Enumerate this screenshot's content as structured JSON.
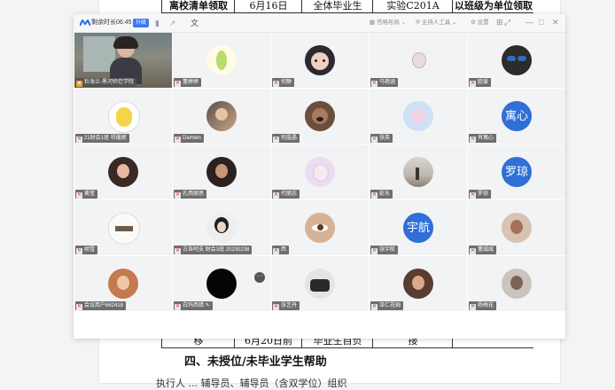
{
  "document": {
    "top_row": [
      "离校清单领取",
      "6月16日",
      "全体毕业生",
      "实验C201A",
      "以班级为单位领取"
    ],
    "bottom_row": [
      "移",
      "6月20日前",
      "毕业生自负",
      "接",
      ""
    ],
    "section_heading": "四、未授位/未毕业学生帮助",
    "subtext": "执行人 ... 辅导员、辅导员（含双学位）组织"
  },
  "meeting": {
    "title": {
      "remaining": "剩余时长06:45",
      "badge": "升级",
      "layout": "宫格布局",
      "host_tools": "主持人工具",
      "settings": "设置"
    },
    "colors": {
      "accent": "#3a78f2",
      "tile_bg": "#f2f3f5",
      "text_avatar": "#2f6fd6"
    },
    "participants": [
      {
        "name": "杜海兰-黑河师范学院",
        "video": true
      },
      {
        "name": "董婷婷",
        "icon": "avatar-pear"
      },
      {
        "name": "何静",
        "icon": "avatar-cartoon-girl"
      },
      {
        "name": "马艳涵",
        "icon": "avatar-hand-drawn"
      },
      {
        "name": "欧爱",
        "icon": "avatar-sunglasses"
      },
      {
        "name": "21财会1班 祁蕴妮",
        "icon": "avatar-yellow-character"
      },
      {
        "name": "Damien",
        "icon": "avatar-photo"
      },
      {
        "name": "何晶晶",
        "icon": "avatar-dog"
      },
      {
        "name": "张英",
        "icon": "avatar-anime"
      },
      {
        "name": "肖寓心",
        "text": "寓心"
      },
      {
        "name": "黄莹",
        "icon": "avatar-portrait"
      },
      {
        "name": "孔西丽思",
        "icon": "avatar-portrait"
      },
      {
        "name": "代丽志",
        "icon": "avatar-anime"
      },
      {
        "name": "彭东",
        "icon": "avatar-landscape"
      },
      {
        "name": "罗琼",
        "text": "罗琼"
      },
      {
        "name": "胡雪",
        "icon": "avatar-room"
      },
      {
        "name": "古各阿支 财会3班 20230238",
        "icon": "avatar-portrait"
      },
      {
        "name": "西",
        "icon": "avatar-eye"
      },
      {
        "name": "张宇航",
        "text": "宇航"
      },
      {
        "name": "董威威",
        "icon": "avatar-portrait"
      },
      {
        "name": "会议用户662418",
        "icon": "avatar-portrait"
      },
      {
        "name": "白玛西措",
        "icon": "avatar-black"
      },
      {
        "name": "张艺丹",
        "icon": "avatar-bag"
      },
      {
        "name": "泽仁花姆",
        "icon": "avatar-portrait"
      },
      {
        "name": "杨梅花",
        "icon": "avatar-portrait"
      }
    ]
  }
}
